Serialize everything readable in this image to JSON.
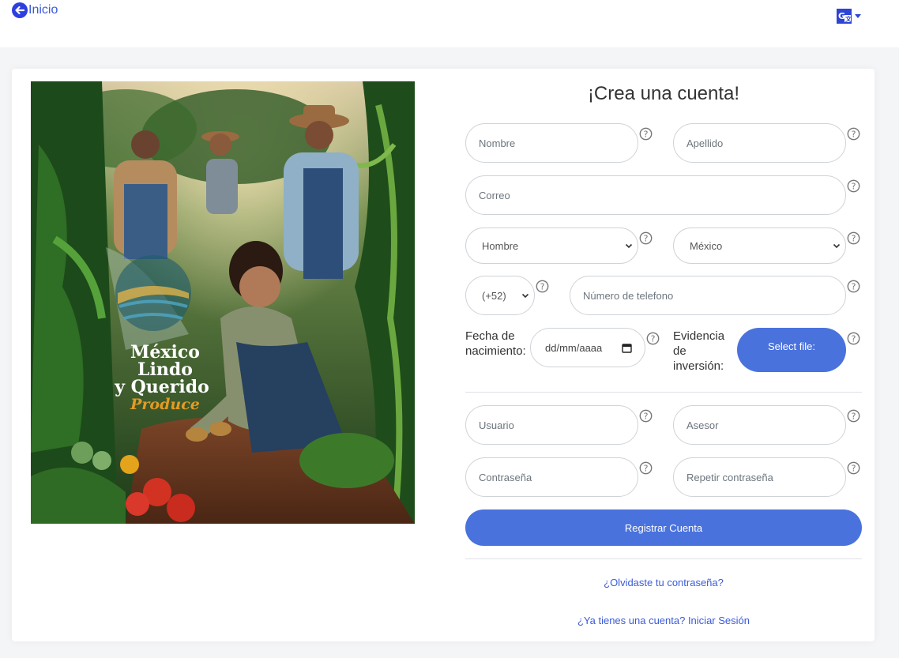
{
  "nav": {
    "back_label": "Inicio"
  },
  "hero": {
    "logo_line1": "México",
    "logo_line2": "Lindo",
    "logo_line3": "y Querido",
    "logo_line4": "Produce"
  },
  "form": {
    "title": "¡Crea una cuenta!",
    "nombre_placeholder": "Nombre",
    "apellido_placeholder": "Apellido",
    "correo_placeholder": "Correo",
    "gender_selected": "Hombre",
    "country_selected": "México",
    "phone_code_selected": "(+52)",
    "phone_placeholder": "Número de telefono",
    "birth_label_1": "Fecha de",
    "birth_label_2": "nacimiento:",
    "date_placeholder": "dd/mm/aaaa",
    "evidence_label_1": "Evidencia",
    "evidence_label_2": "de",
    "evidence_label_3": "inversión:",
    "file_button": "Select file:",
    "usuario_placeholder": "Usuario",
    "asesor_placeholder": "Asesor",
    "password_placeholder": "Contraseña",
    "repeat_password_placeholder": "Repetir contraseña",
    "submit_label": "Registrar Cuenta",
    "forgot_link": "¿Olvidaste tu contraseña?",
    "login_link": "¿Ya tienes una cuenta? Iniciar Sesión"
  },
  "colors": {
    "accent": "#4a72dd",
    "link": "#3b5bd9",
    "icon_blue": "#2d3fe0"
  }
}
